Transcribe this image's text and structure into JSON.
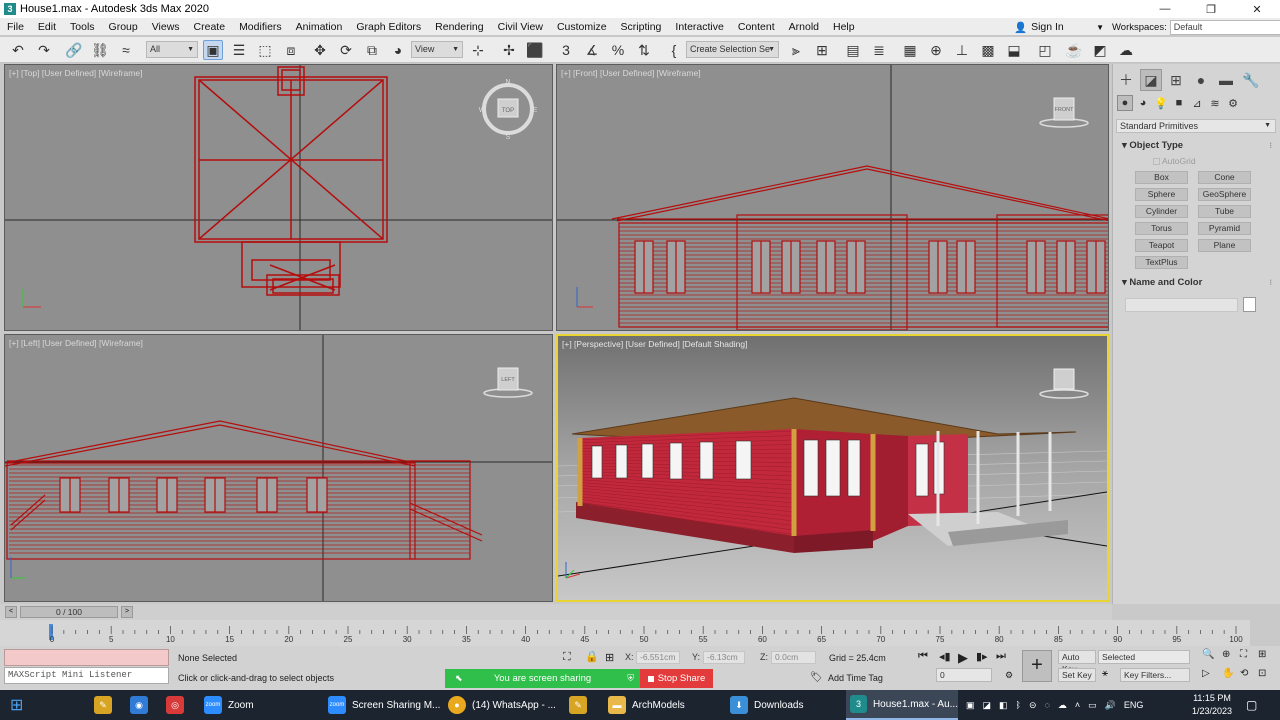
{
  "window": {
    "title": "House1.max - Autodesk 3ds Max 2020",
    "icon": "3",
    "controls": [
      "—",
      "❐",
      "✕"
    ]
  },
  "menu": [
    "File",
    "Edit",
    "Tools",
    "Group",
    "Views",
    "Create",
    "Modifiers",
    "Animation",
    "Graph Editors",
    "Rendering",
    "Civil View",
    "Customize",
    "Scripting",
    "Interactive",
    "Content",
    "Arnold",
    "Help"
  ],
  "signin": {
    "label": "Sign In"
  },
  "workspace": {
    "label": "Workspaces:",
    "value": "Default"
  },
  "toolbar": {
    "filter": "All",
    "refcoord": "View",
    "selection_set": "Create Selection Se"
  },
  "viewports": {
    "top": {
      "label": "[+] [Top] [User Defined] [Wireframe]",
      "cube": "TOP",
      "compass": [
        "N",
        "E",
        "S",
        "W"
      ]
    },
    "front": {
      "label": "[+] [Front] [User Defined] [Wireframe]",
      "cube": "FRONT"
    },
    "left": {
      "label": "[+] [Left] [User Defined] [Wireframe]",
      "cube": "LEFT"
    },
    "persp": {
      "label": "[+] [Perspective] [User Defined] [Default Shading]"
    }
  },
  "colors": {
    "wire": "#b50d0d",
    "active_border": "#e8d532",
    "walls": "#c2283c",
    "roof": "#8a5a2a"
  },
  "command_panel": {
    "dropdown": "Standard Primitives",
    "object_type": {
      "title": "Object Type",
      "autogrid": "AutoGrid",
      "buttons": [
        "Box",
        "Cone",
        "Sphere",
        "GeoSphere",
        "Cylinder",
        "Tube",
        "Torus",
        "Pyramid",
        "Teapot",
        "Plane",
        "TextPlus"
      ]
    },
    "name_color": {
      "title": "Name and Color"
    }
  },
  "time": {
    "slider": "0 / 100",
    "ticks": [
      "0",
      "5",
      "10",
      "15",
      "20",
      "25",
      "30",
      "35",
      "40",
      "45",
      "50",
      "55",
      "60",
      "65",
      "70",
      "75",
      "80",
      "85",
      "90",
      "95",
      "100"
    ]
  },
  "status": {
    "listener": "MAXScript Mini Listener",
    "selection": "None Selected",
    "prompt": "Click or click-and-drag to select objects",
    "x_label": "X:",
    "x": "-6.551cm",
    "y_label": "Y:",
    "y": "-6.13cm",
    "z_label": "Z:",
    "z": "0.0cm",
    "grid": "Grid = 25.4cm",
    "add_time_tag": "Add Time Tag",
    "auto_key": "Auto Key",
    "set_key": "Set Key",
    "selected": "Selected",
    "key_filters": "Key Filters...",
    "frame": "0"
  },
  "share": {
    "text": "You are screen sharing",
    "stop": "Stop Share"
  },
  "taskbar": {
    "items": [
      {
        "label": "Zoom",
        "icon_color": "#2d8cff",
        "icon": "zoom"
      },
      {
        "label": "Screen Sharing M...",
        "icon_color": "#2d8cff",
        "icon": "zoom"
      },
      {
        "label": "(14) WhatsApp - ...",
        "icon_color": "#e8a91f",
        "icon": "●"
      },
      {
        "label": "ArchModels",
        "icon_color": "#e9b84a",
        "icon": "▬"
      },
      {
        "label": "Downloads",
        "icon_color": "#3a8fd8",
        "icon": "⬇"
      },
      {
        "label": "House1.max - Au...",
        "icon_color": "#1f8b8b",
        "icon": "3"
      }
    ],
    "lang": "ENG",
    "time": "11:15 PM",
    "date": "1/23/2023"
  }
}
